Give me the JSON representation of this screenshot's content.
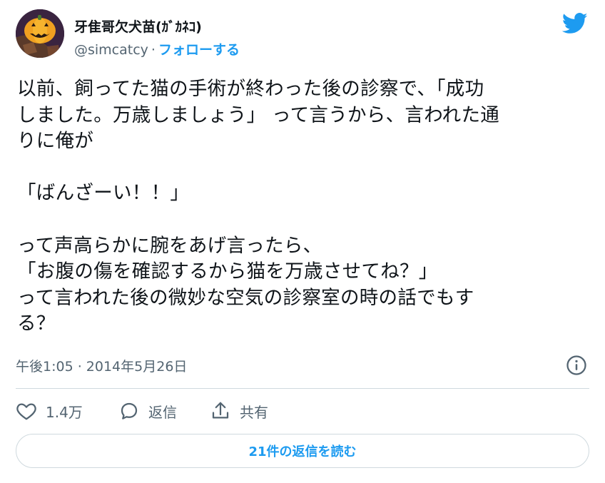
{
  "header": {
    "display_name": "牙隹哥欠犬苗(ｶﾞｶﾈｺ)",
    "handle": "@simcatcy",
    "separator": "·",
    "follow_label": "フォローする"
  },
  "tweet": {
    "lines": [
      "以前、飼ってた猫の手術が終わった後の診察で、「成功",
      "しました。万歳しましょう」 って言うから、言われた通",
      "りに俺が",
      "",
      "「ばんざーい！！」",
      "",
      "って声高らかに腕をあげ言ったら、",
      "「お腹の傷を確認するから猫を万歳させてね？」",
      "って言われた後の微妙な空気の診察室の時の話でもす",
      "る？"
    ],
    "timestamp": "午後1:05 · 2014年5月26日"
  },
  "actions": {
    "like_count": "1.4万",
    "reply_label": "返信",
    "share_label": "共有",
    "read_replies_label": "21件の返信を読む"
  },
  "icons": {
    "logo": "twitter-bird-icon",
    "info": "info-icon",
    "like": "heart-icon",
    "reply": "speech-bubble-icon",
    "share": "share-icon"
  },
  "colors": {
    "accent": "#1d9bf0",
    "text": "#0f1419",
    "secondary": "#536471",
    "border": "#cfd9de"
  }
}
